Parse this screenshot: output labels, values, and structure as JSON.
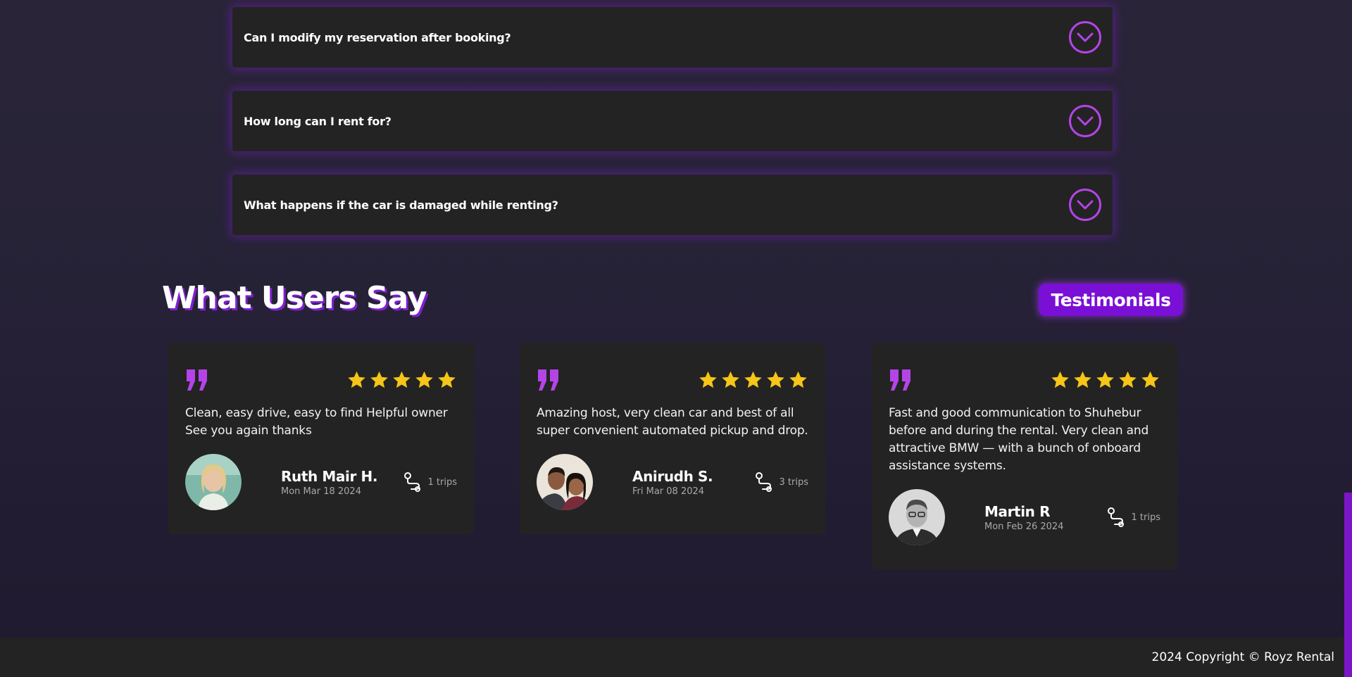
{
  "faq": {
    "items": [
      {
        "question": "Can I modify my reservation after booking?"
      },
      {
        "question": "How long can I rent for?"
      },
      {
        "question": "What happens if the car is damaged while renting?"
      }
    ]
  },
  "testimonials": {
    "title": "What Users Say",
    "badge": "Testimonials",
    "reviews": [
      {
        "text": "Clean, easy drive, easy to find Helpful owner See you again thanks",
        "name": "Ruth Mair H.",
        "date": "Mon Mar 18 2024",
        "trips": "1 trips",
        "rating": 5
      },
      {
        "text": "Amazing host, very clean car and best of all super convenient automated pickup and drop.",
        "name": "Anirudh S.",
        "date": "Fri Mar 08 2024",
        "trips": "3 trips",
        "rating": 5
      },
      {
        "text": "Fast and good communication to Shuhebur before and during the rental. Very clean and attractive BMW — with a bunch of onboard assistance systems.",
        "name": "Martin R",
        "date": "Mon Feb 26 2024",
        "trips": "1 trips",
        "rating": 5
      }
    ]
  },
  "footer": {
    "copyright": "2024 Copyright © Royz Rental"
  },
  "colors": {
    "accent": "#7a0fd6",
    "icon_purple": "#b444e8",
    "star": "#f5c518",
    "card_bg": "#232323"
  },
  "icons": {
    "faq_toggle": "chevron-down-circle-icon",
    "quote": "quote-icon",
    "star": "star-icon",
    "trips": "route-icon"
  }
}
